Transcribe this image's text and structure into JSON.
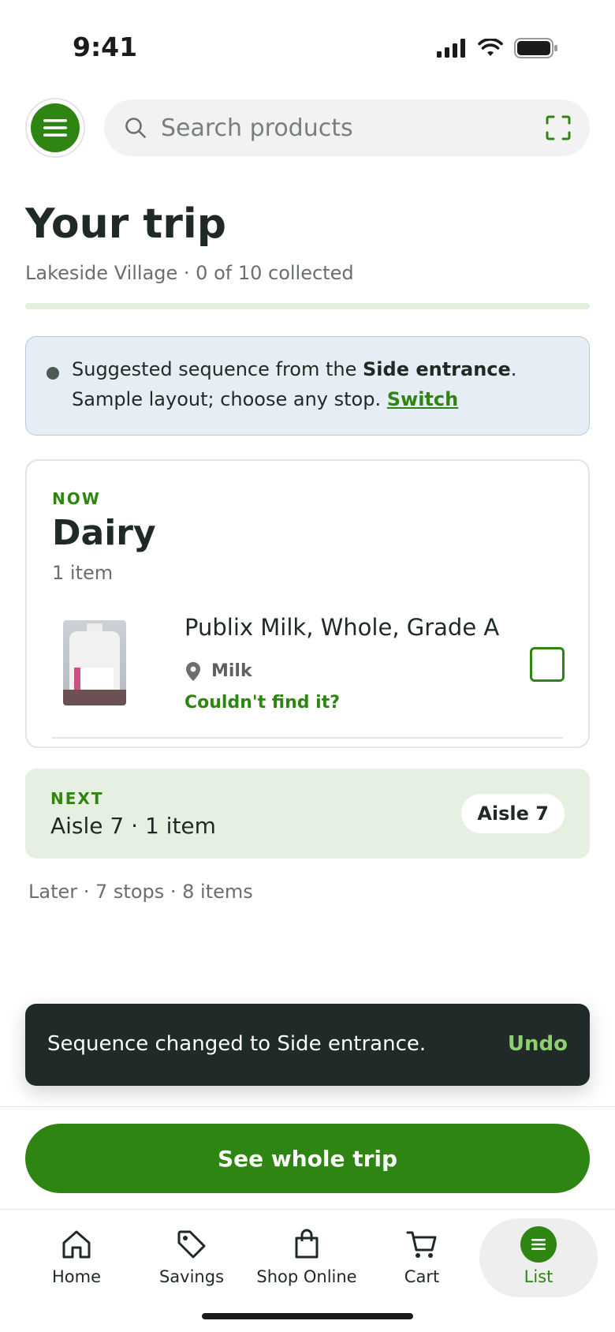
{
  "status_bar": {
    "time": "9:41"
  },
  "search": {
    "placeholder": "Search products"
  },
  "page": {
    "title": "Your trip",
    "subtitle": "Lakeside Village · 0 of 10 collected",
    "progress_collected": 0,
    "progress_total": 10
  },
  "notice": {
    "text_before": "Suggested sequence from the ",
    "entrance": "Side entrance",
    "text_after": ". Sample layout; choose any stop. ",
    "switch_label": "Switch"
  },
  "now_section": {
    "label": "NOW",
    "title": "Dairy",
    "count": "1 item",
    "item": {
      "name": "Publix Milk, Whole, Grade A",
      "location": "Milk",
      "not_found_label": "Couldn't find it?",
      "checked": false
    }
  },
  "next_section": {
    "label": "NEXT",
    "text": "Aisle 7 · 1 item",
    "pill": "Aisle 7"
  },
  "later": "Later · 7 stops · 8 items",
  "snackbar": {
    "message": "Sequence changed to Side entrance.",
    "action": "Undo"
  },
  "primary_button": "See whole trip",
  "tabs": [
    {
      "label": "Home",
      "icon": "home-icon"
    },
    {
      "label": "Savings",
      "icon": "tag-icon"
    },
    {
      "label": "Shop Online",
      "icon": "bag-icon"
    },
    {
      "label": "Cart",
      "icon": "cart-icon"
    },
    {
      "label": "List",
      "icon": "list-icon",
      "active": true
    }
  ],
  "colors": {
    "brand_green": "#2e8512",
    "snackbar_bg": "#1f2a29",
    "notice_bg": "#e7edf4",
    "next_bg": "#e6f0e2"
  }
}
